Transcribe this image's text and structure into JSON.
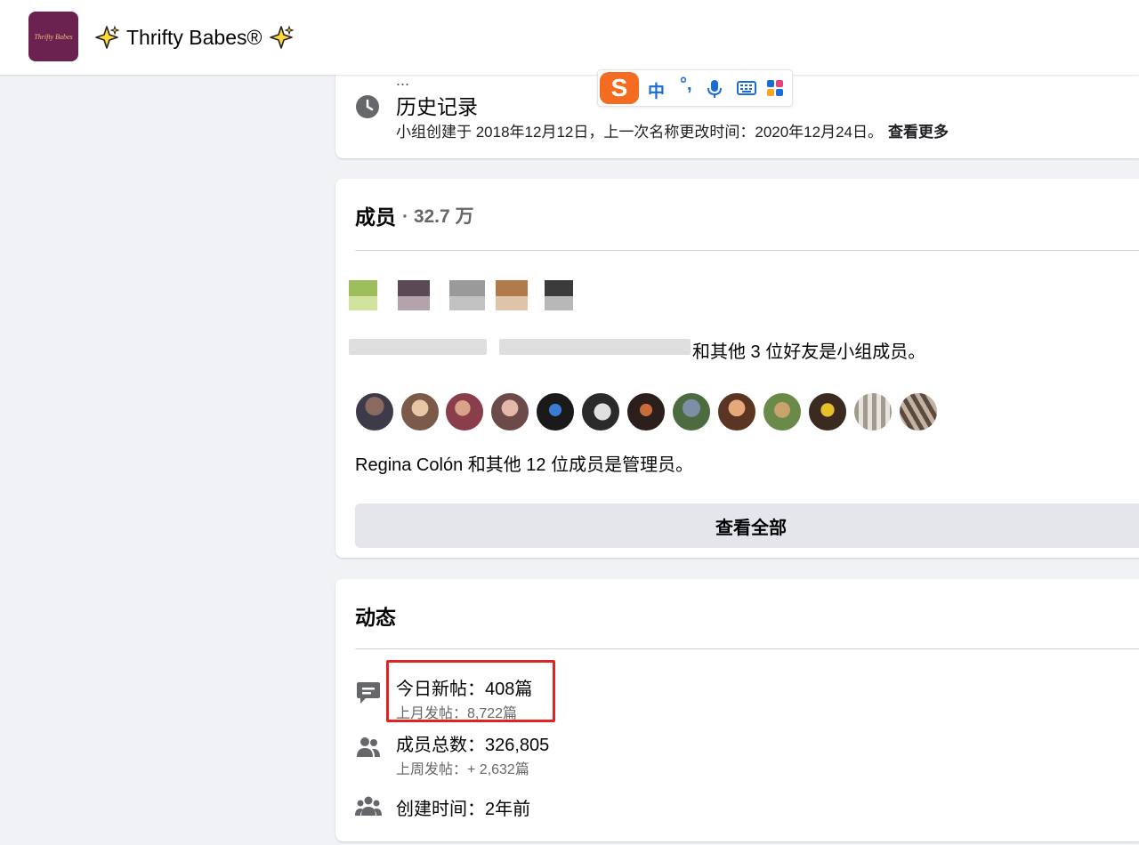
{
  "header": {
    "logo_text": "Thrifty Babes",
    "group_name": "Thrifty Babes®"
  },
  "about_card": {
    "cut_text": "...",
    "history_title": "历史记录",
    "history_detail": "小组创建于 2018年12月12日，上一次名称更改时间：2020年12月24日。",
    "see_more": "查看更多"
  },
  "ime_toolbar": {
    "logo": "S",
    "mode": "中",
    "punct": "°,",
    "icons": [
      "microphone-icon",
      "keyboard-icon",
      "grid-icon"
    ],
    "brand_color": "#f36c21"
  },
  "members_card": {
    "title": "成员",
    "count": "· 32.7 万",
    "friends_text": "和其他 3 位好友是小组成员。",
    "admins_text": "Regina Colón 和其他 12 位成员是管理员。",
    "see_all_label": "查看全部"
  },
  "activity_card": {
    "title": "动态",
    "items": [
      {
        "icon": "chat-bubble-icon",
        "main": "今日新帖：408篇",
        "sub": "上月发帖：8,722篇"
      },
      {
        "icon": "two-people-icon",
        "main": "成员总数：326,805",
        "sub": "上周发帖：+ 2,632篇"
      },
      {
        "icon": "group-icon",
        "main": "创建时间：2年前",
        "sub": ""
      }
    ],
    "highlight_color": "#e02424"
  }
}
